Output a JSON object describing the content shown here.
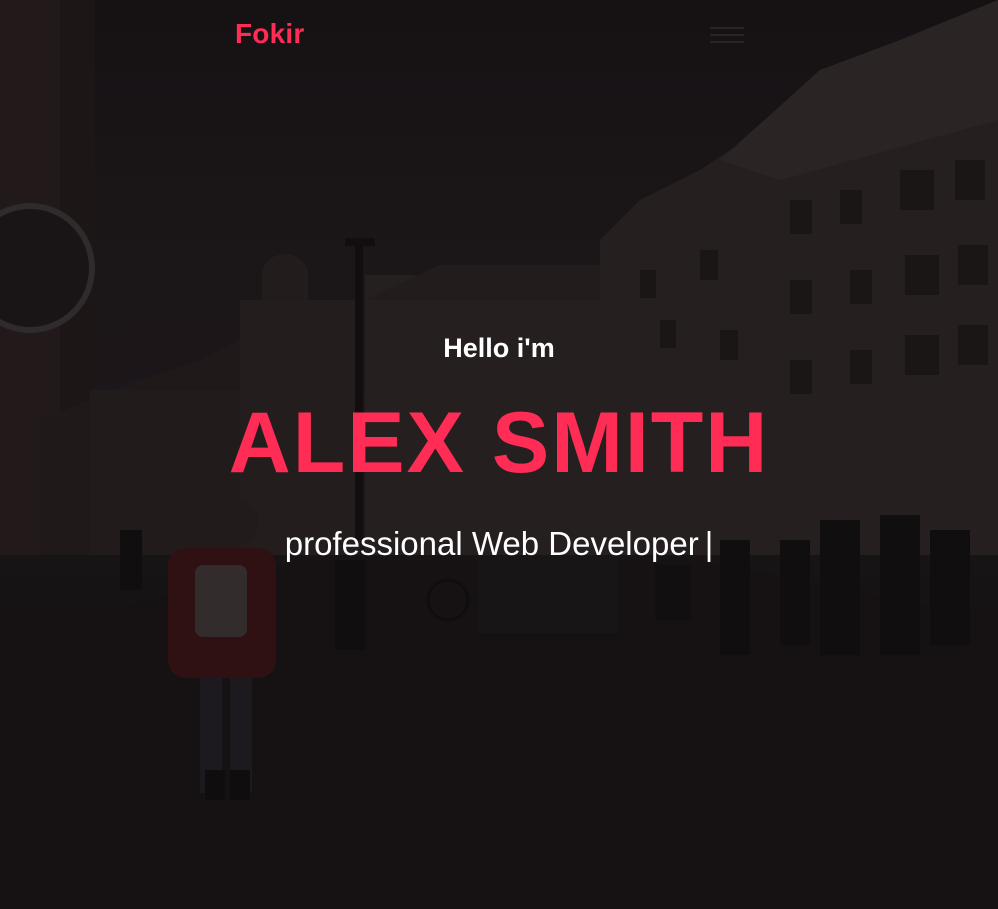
{
  "nav": {
    "brand": "Fokir"
  },
  "hero": {
    "greeting": "Hello i'm",
    "name": "ALEX SMITH",
    "tagline": "professional Web Developer",
    "cursor": "|"
  },
  "colors": {
    "accent": "#ff2d55",
    "text": "#ffffff",
    "background": "#1a1618"
  },
  "icons": {
    "menu": "hamburger-menu-icon"
  }
}
